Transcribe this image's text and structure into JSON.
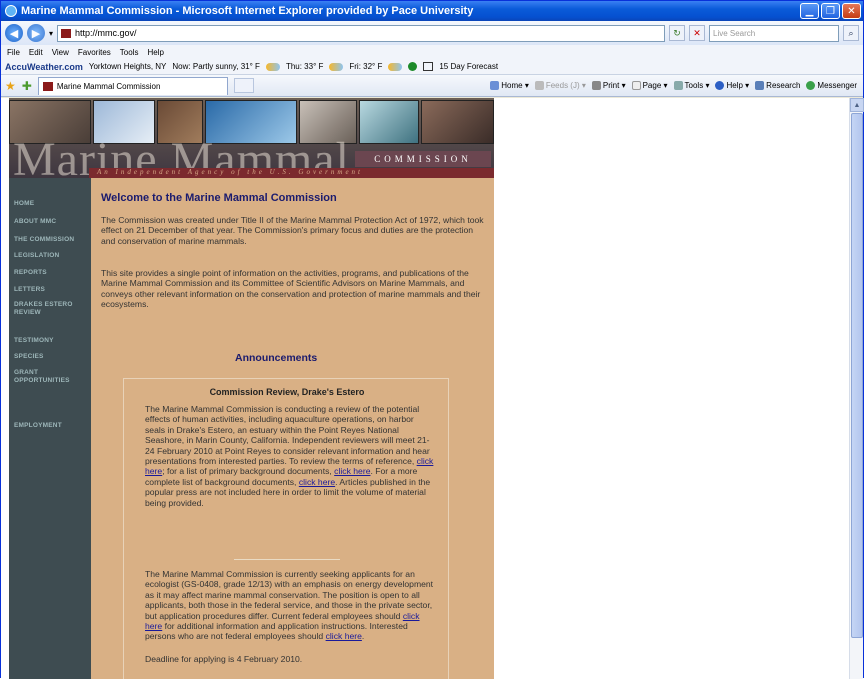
{
  "window": {
    "title": "Marine Mammal Commission - Microsoft Internet Explorer provided by Pace University"
  },
  "address": {
    "url": "http://mmc.gov/",
    "search_placeholder": "Live Search"
  },
  "menu": [
    "File",
    "Edit",
    "View",
    "Favorites",
    "Tools",
    "Help"
  ],
  "accuweather": {
    "brand": "AccuWeather.com",
    "location": "Yorktown Heights, NY",
    "now": "Now: Partly sunny, 31° F",
    "thu": "Thu: 33° F",
    "fri": "Fri: 32° F",
    "forecast": "15 Day Forecast"
  },
  "tab": {
    "label": "Marine Mammal Commission"
  },
  "commandbar": {
    "home": "Home",
    "feeds": "Feeds (J)",
    "print": "Print",
    "page": "Page",
    "tools": "Tools",
    "help": "Help",
    "research": "Research",
    "messenger": "Messenger"
  },
  "site": {
    "banner_title": "Marine Mammal",
    "banner_commission": "COMMISSION",
    "tagline": "An Independent Agency of the U.S. Government",
    "nav": [
      "HOME",
      "ABOUT MMC",
      "THE COMMISSION",
      "LEGISLATION",
      "REPORTS",
      "LETTERS",
      "DRAKES ESTERO REVIEW",
      "TESTIMONY",
      "SPECIES",
      "GRANT OPPORTUNITIES",
      "EMPLOYMENT"
    ],
    "welcome": "Welcome to the Marine Mammal Commission",
    "p1": "The Commission was created under Title II of the Marine Mammal Protection Act of 1972, which took effect on 21 December of that year. The Commission's primary focus and duties are the protection and conservation of marine mammals.",
    "p2": "This site provides a single point of information on the activities, programs, and publications of the Marine Mammal Commission and its Committee of Scientific Advisors on Marine Mammals, and conveys other relevant information on the conservation and protection of marine mammals and their ecosystems.",
    "announcements": "Announcements",
    "box_heading": "Commission Review, Drake's Estero",
    "box_p1_a": "The Marine Mammal Commission is conducting a review of the potential effects of human activities, including aquaculture operations, on harbor seals in Drake's Estero, an estuary within the Point Reyes National Seashore, in Marin County, California. Independent reviewers will meet 21-24 February 2010 at Point Reyes to consider relevant information and hear presentations from interested parties. To review the terms of reference,",
    "box_p1_link1": "click here",
    "box_p1_b": "; for a list of primary background documents,",
    "box_p1_link2": "click here",
    "box_p1_c": ". For a more complete list of background documents,",
    "box_p1_link3": "click here",
    "box_p1_d": ". Articles published in the popular press are not included here in order to limit the volume of material being provided.",
    "box_p2_a": "The Marine Mammal Commission is currently seeking applicants for an ecologist (GS-0408, grade 12/13) with an emphasis on energy development as it may affect marine mammal conservation. The position is open to all applicants, both those in the federal service, and those in the private sector, but application procedures differ. Current federal employees should",
    "box_p2_link1": "click here",
    "box_p2_b": "for additional information and application instructions. Interested persons who are not federal employees should",
    "box_p2_link2": "click here",
    "box_p2_c": ".",
    "deadline": "Deadline for applying is 4 February 2010."
  }
}
